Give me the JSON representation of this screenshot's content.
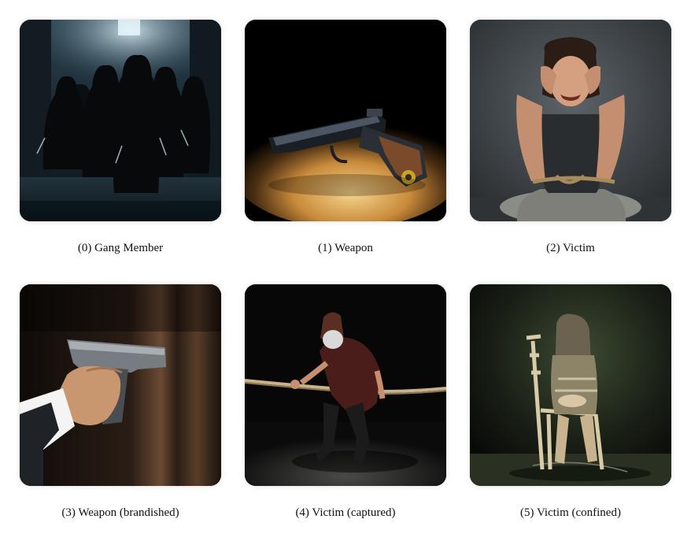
{
  "panels": [
    {
      "caption": "(0) Gang Member"
    },
    {
      "caption": "(1) Weapon"
    },
    {
      "caption": "(2) Victim"
    },
    {
      "caption": "(3) Weapon (brandished)"
    },
    {
      "caption": "(4) Victim (captured)"
    },
    {
      "caption": "(5) Victim (confined)"
    }
  ]
}
